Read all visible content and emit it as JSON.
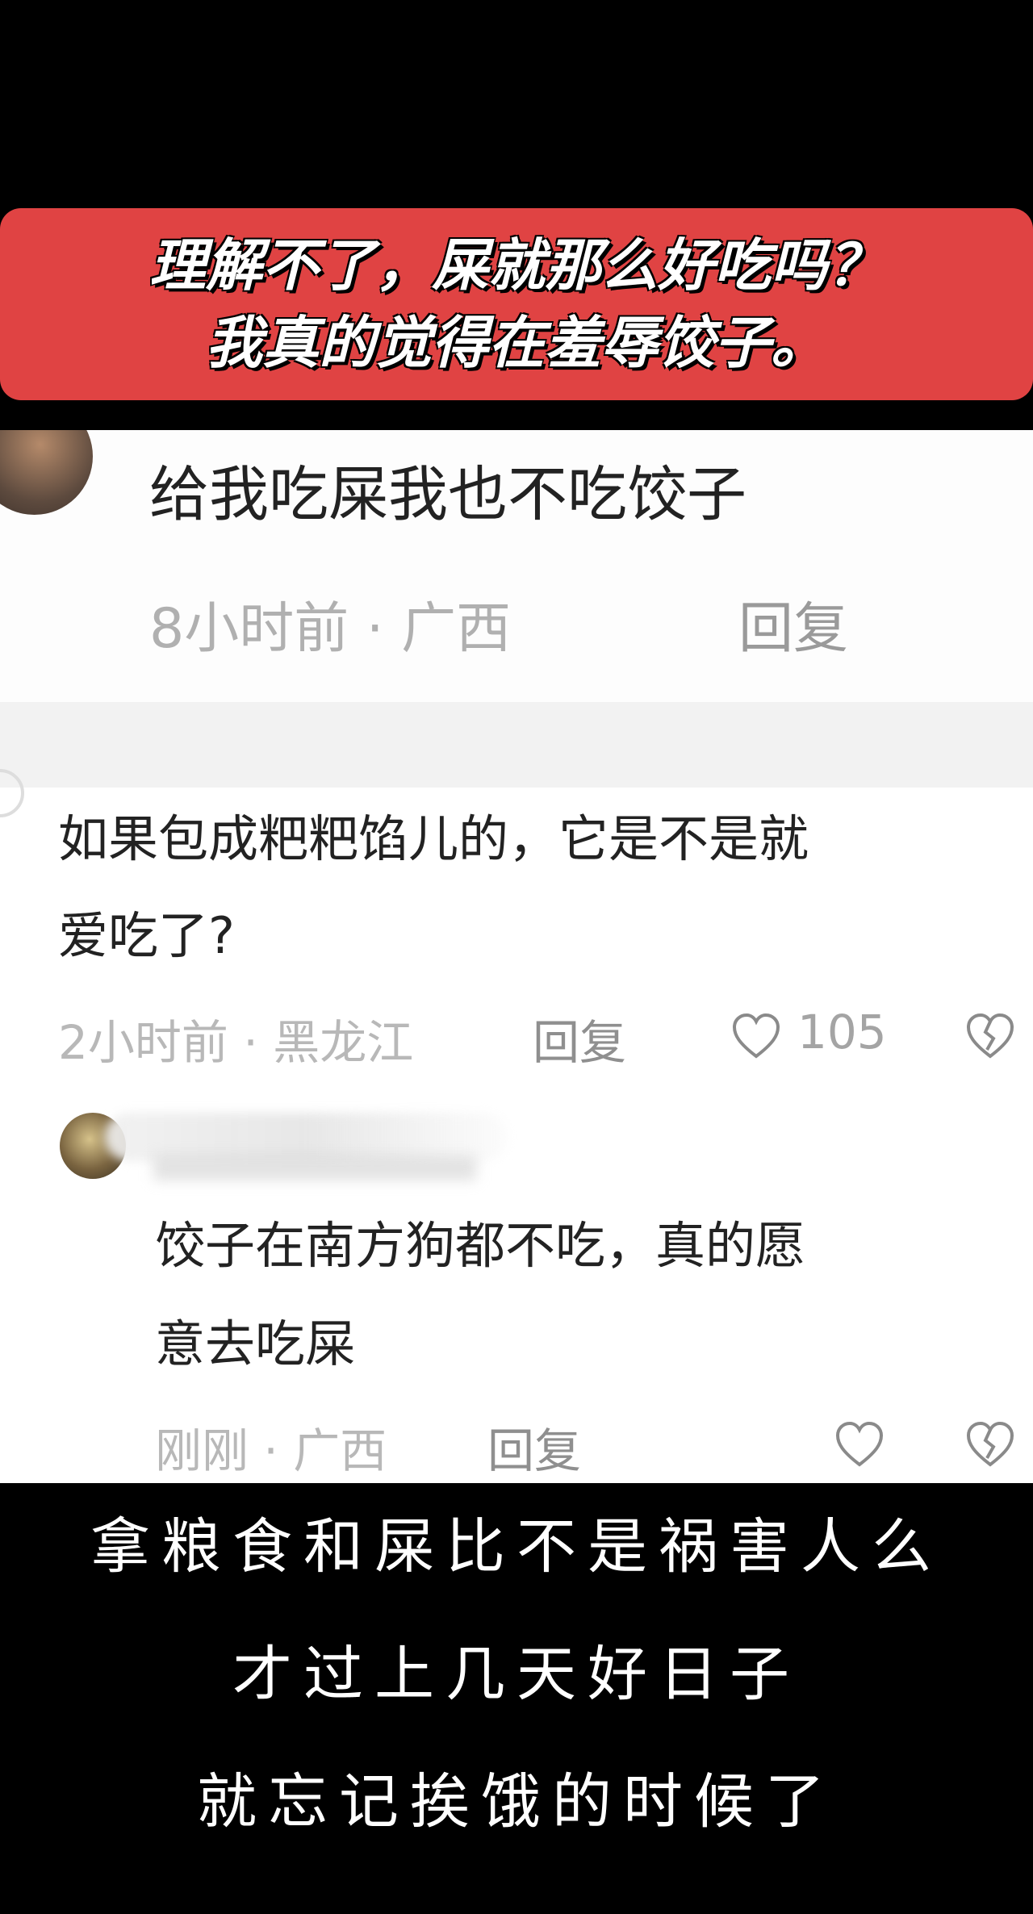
{
  "banner": {
    "line1": "理解不了，屎就那么好吃吗？",
    "line2": "我真的觉得在羞辱饺子。",
    "color": "#e04343"
  },
  "comments": [
    {
      "text": "给我吃屎我也不吃饺子",
      "meta": "8小时前 · 广西",
      "reply": "回复"
    },
    {
      "text_line1": "如果包成粑粑馅儿的，它是不是就",
      "text_line2": "爱吃了?",
      "meta": "2小时前 · 黑龙江",
      "reply": "回复",
      "likes": "105",
      "icons": [
        "heart-icon",
        "broken-heart-icon"
      ]
    },
    {
      "text_line1": "饺子在南方狗都不吃，真的愿",
      "text_line2": "意去吃屎",
      "meta": "刚刚 · 广西",
      "reply": "回复",
      "icons": [
        "heart-icon",
        "broken-heart-icon"
      ]
    }
  ],
  "caption": {
    "line1": "拿粮食和屎比不是祸害人么",
    "line2": "才过上几天好日子",
    "line3": "就忘记挨饿的时候了"
  }
}
